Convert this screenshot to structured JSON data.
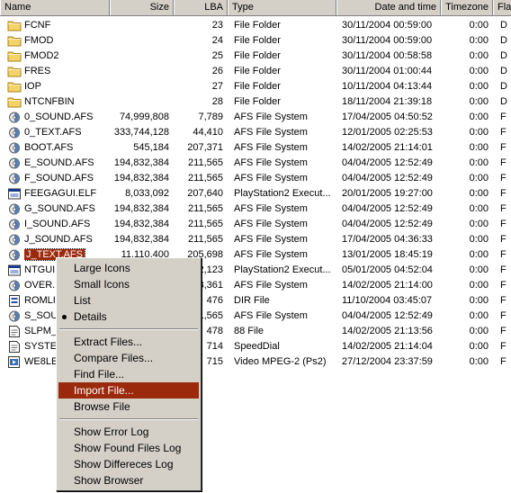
{
  "columns": {
    "name": "Name",
    "size": "Size",
    "lba": "LBA",
    "type": "Type",
    "date": "Date and time",
    "timezone": "Timezone",
    "flags": "Fla"
  },
  "rows": [
    {
      "icon": "folder-icon",
      "name": "FCNF",
      "size": "",
      "lba": "23",
      "type": "File Folder",
      "date": "30/11/2004 00:59:00",
      "tz": "0:00",
      "flag": "D"
    },
    {
      "icon": "folder-icon",
      "name": "FMOD",
      "size": "",
      "lba": "24",
      "type": "File Folder",
      "date": "30/11/2004 00:59:00",
      "tz": "0:00",
      "flag": "D"
    },
    {
      "icon": "folder-icon",
      "name": "FMOD2",
      "size": "",
      "lba": "25",
      "type": "File Folder",
      "date": "30/11/2004 00:58:58",
      "tz": "0:00",
      "flag": "D"
    },
    {
      "icon": "folder-icon",
      "name": "FRES",
      "size": "",
      "lba": "26",
      "type": "File Folder",
      "date": "30/11/2004 01:00:44",
      "tz": "0:00",
      "flag": "D"
    },
    {
      "icon": "folder-icon",
      "name": "IOP",
      "size": "",
      "lba": "27",
      "type": "File Folder",
      "date": "10/11/2004 04:13:44",
      "tz": "0:00",
      "flag": "D"
    },
    {
      "icon": "folder-icon",
      "name": "NTCNFBIN",
      "size": "",
      "lba": "28",
      "type": "File Folder",
      "date": "18/11/2004 21:39:18",
      "tz": "0:00",
      "flag": "D"
    },
    {
      "icon": "afs-file-icon",
      "name": "0_SOUND.AFS",
      "size": "74,999,808",
      "lba": "7,789",
      "type": "AFS File System",
      "date": "17/04/2005 04:50:52",
      "tz": "0:00",
      "flag": "F"
    },
    {
      "icon": "afs-file-icon",
      "name": "0_TEXT.AFS",
      "size": "333,744,128",
      "lba": "44,410",
      "type": "AFS File System",
      "date": "12/01/2005 02:25:53",
      "tz": "0:00",
      "flag": "F"
    },
    {
      "icon": "afs-file-icon",
      "name": "BOOT.AFS",
      "size": "545,184",
      "lba": "207,371",
      "type": "AFS File System",
      "date": "14/02/2005 21:14:01",
      "tz": "0:00",
      "flag": "F"
    },
    {
      "icon": "afs-file-icon",
      "name": "E_SOUND.AFS",
      "size": "194,832,384",
      "lba": "211,565",
      "type": "AFS File System",
      "date": "04/04/2005 12:52:49",
      "tz": "0:00",
      "flag": "F"
    },
    {
      "icon": "afs-file-icon",
      "name": "F_SOUND.AFS",
      "size": "194,832,384",
      "lba": "211,565",
      "type": "AFS File System",
      "date": "04/04/2005 12:52:49",
      "tz": "0:00",
      "flag": "F"
    },
    {
      "icon": "elf-file-icon",
      "name": "FEEGAGUI.ELF",
      "size": "8,033,092",
      "lba": "207,640",
      "type": "PlayStation2 Execut...",
      "date": "20/01/2005 19:27:00",
      "tz": "0:00",
      "flag": "F"
    },
    {
      "icon": "afs-file-icon",
      "name": "G_SOUND.AFS",
      "size": "194,832,384",
      "lba": "211,565",
      "type": "AFS File System",
      "date": "04/04/2005 12:52:49",
      "tz": "0:00",
      "flag": "F"
    },
    {
      "icon": "afs-file-icon",
      "name": "I_SOUND.AFS",
      "size": "194,832,384",
      "lba": "211,565",
      "type": "AFS File System",
      "date": "04/04/2005 12:52:49",
      "tz": "0:00",
      "flag": "F"
    },
    {
      "icon": "afs-file-icon",
      "name": "J_SOUND.AFS",
      "size": "194,832,384",
      "lba": "211,565",
      "type": "AFS File System",
      "date": "17/04/2005 04:36:33",
      "tz": "0:00",
      "flag": "F"
    },
    {
      "icon": "afs-file-icon",
      "name": "J_TEXT.AFS",
      "size": "11,110,400",
      "lba": "205,698",
      "type": "AFS File System",
      "date": "13/01/2005 18:45:19",
      "tz": "0:00",
      "flag": "F",
      "selected": true
    },
    {
      "icon": "elf-file-icon",
      "name": "NTGUI",
      "size": "",
      "lba": "2,123",
      "type": "PlayStation2 Execut...",
      "date": "05/01/2005 04:52:04",
      "tz": "0:00",
      "flag": "F"
    },
    {
      "icon": "afs-file-icon",
      "name": "OVER.",
      "size": "",
      "lba": "3,361",
      "type": "AFS File System",
      "date": "14/02/2005 21:14:00",
      "tz": "0:00",
      "flag": "F"
    },
    {
      "icon": "dir-file-icon",
      "name": "ROMLI",
      "size": "",
      "lba": "476",
      "type": "DIR File",
      "date": "11/10/2004 03:45:07",
      "tz": "0:00",
      "flag": "F"
    },
    {
      "icon": "afs-file-icon",
      "name": "S_SOU",
      "size": "",
      "lba": "1,565",
      "type": "AFS File System",
      "date": "04/04/2005 12:52:49",
      "tz": "0:00",
      "flag": "F"
    },
    {
      "icon": "generic-file-icon",
      "name": "SLPM_",
      "size": "",
      "lba": "478",
      "type": "88 File",
      "date": "14/02/2005 21:13:56",
      "tz": "0:00",
      "flag": "F"
    },
    {
      "icon": "generic-file-icon",
      "name": "SYSTE",
      "size": "",
      "lba": "714",
      "type": "SpeedDial",
      "date": "14/02/2005 21:14:04",
      "tz": "0:00",
      "flag": "F"
    },
    {
      "icon": "video-file-icon",
      "name": "WE8LE",
      "size": "",
      "lba": "715",
      "type": "Video MPEG-2 (Ps2)",
      "date": "27/12/2004 23:37:59",
      "tz": "0:00",
      "flag": "F"
    }
  ],
  "context_menu": {
    "items": [
      {
        "label": "Large Icons",
        "name": "menu-large-icons"
      },
      {
        "label": "Small Icons",
        "name": "menu-small-icons"
      },
      {
        "label": "List",
        "name": "menu-list"
      },
      {
        "label": "Details",
        "name": "menu-details",
        "checked": true
      },
      {
        "separator": true
      },
      {
        "label": "Extract Files...",
        "name": "menu-extract-files"
      },
      {
        "label": "Compare Files...",
        "name": "menu-compare-files"
      },
      {
        "label": "Find File...",
        "name": "menu-find-file"
      },
      {
        "label": "Import File...",
        "name": "menu-import-file",
        "highlighted": true
      },
      {
        "label": "Browse File",
        "name": "menu-browse-file"
      },
      {
        "separator": true
      },
      {
        "label": "Show Error Log",
        "name": "menu-show-error-log"
      },
      {
        "label": "Show Found Files Log",
        "name": "menu-show-found-files-log"
      },
      {
        "label": "Show Differeces Log",
        "name": "menu-show-differeces-log"
      },
      {
        "label": "Show Browser",
        "name": "menu-show-browser"
      }
    ]
  },
  "colors": {
    "highlight": "#9b2a0c",
    "chrome": "#d4d0c8",
    "folder": "#f6d36a"
  }
}
